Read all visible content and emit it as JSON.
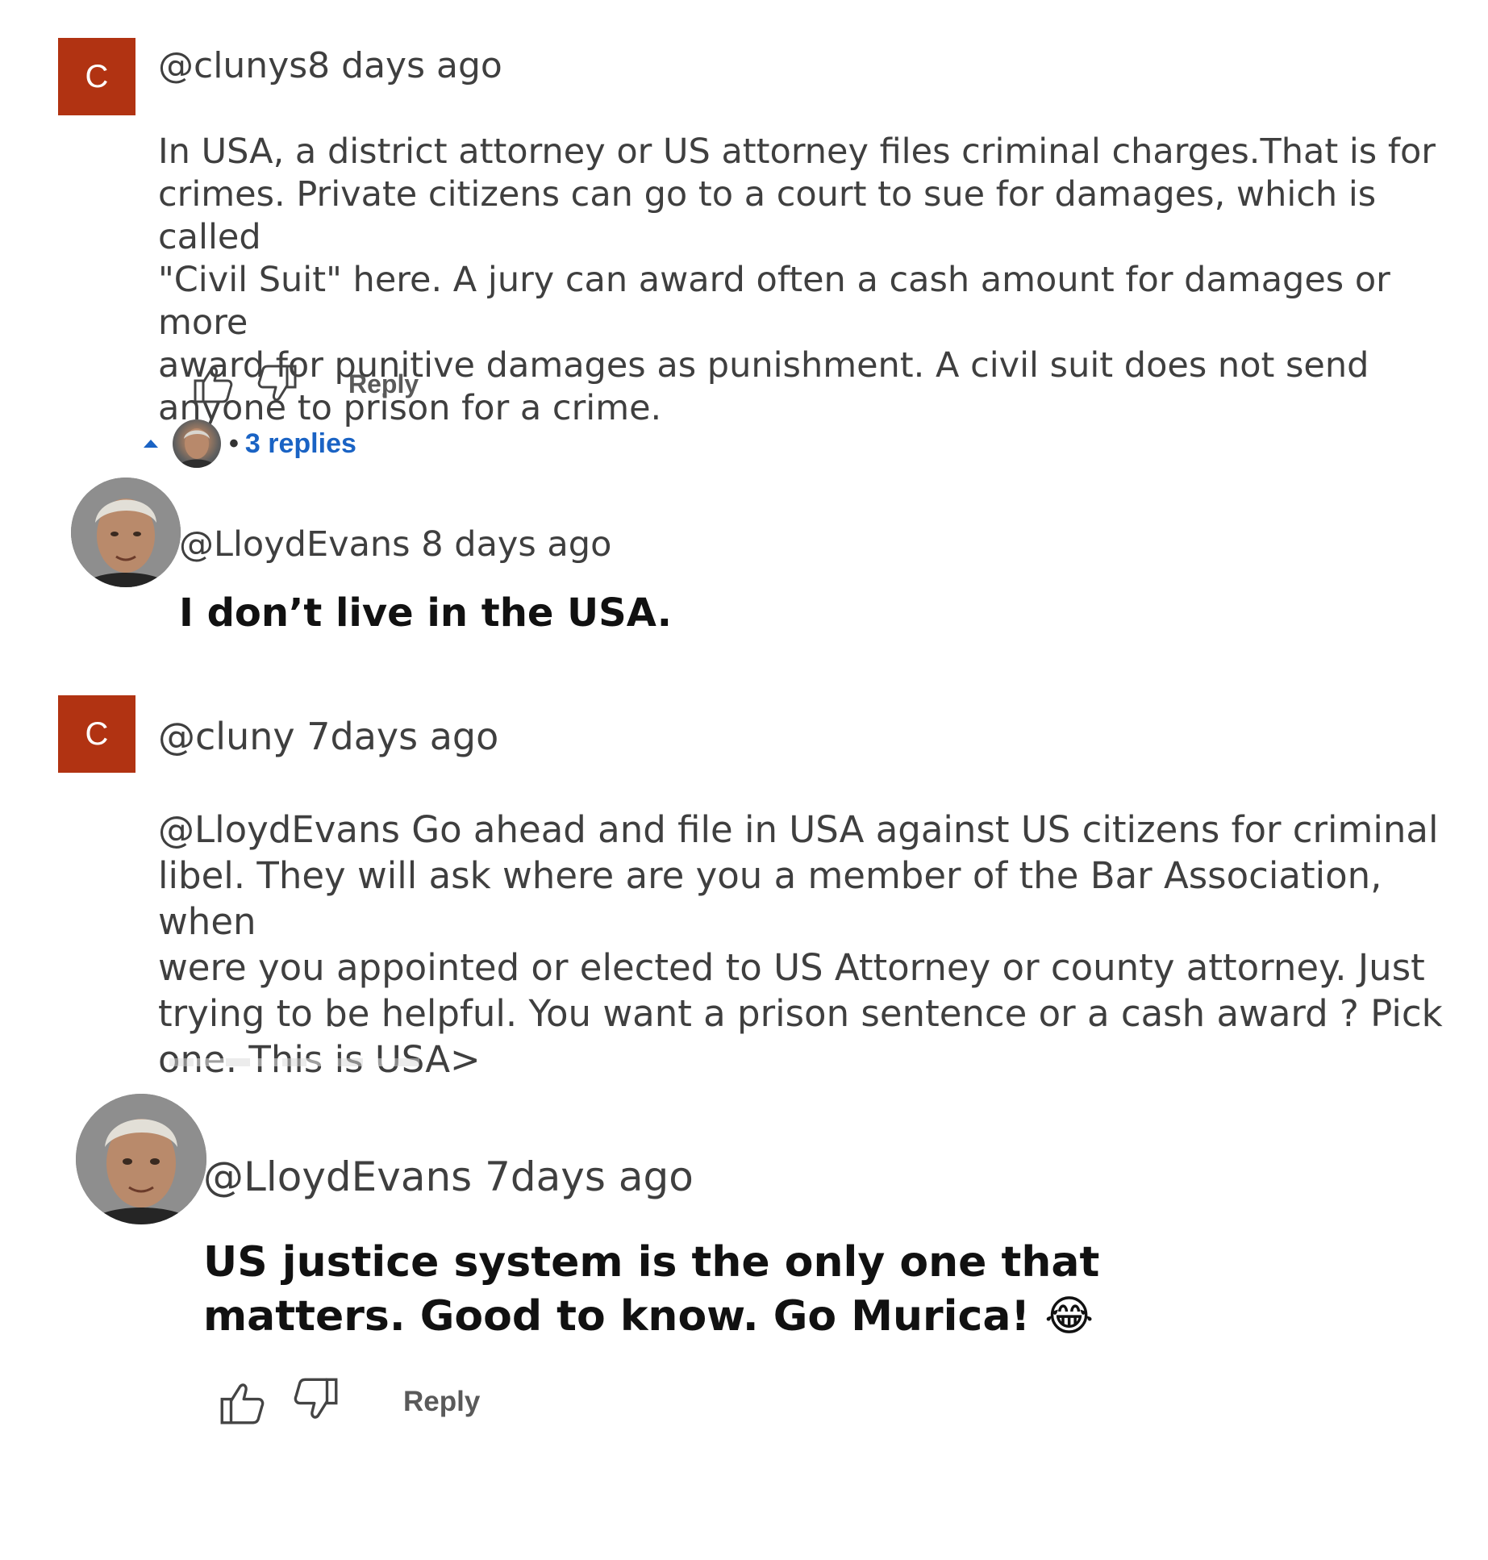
{
  "comments": [
    {
      "avatar_letter": "C",
      "author_line": "@clunys8 days ago",
      "text": "In USA, a district attorney or US attorney files criminal charges.That is for\ncrimes. Private citizens can go to a court to sue for damages, which is called\n\"Civil Suit\" here. A jury can award often a cash amount for damages or more\naward for punitive damages as punishment. A civil suit does not send\nanyone to prison for a crime.",
      "reply_label": "Reply",
      "replies_label": "3 replies"
    },
    {
      "author_line": "@LloydEvans 8 days ago",
      "text": "I don’t live in the USA."
    },
    {
      "avatar_letter": "C",
      "author_line": "@cluny 7days ago",
      "text": " @LloydEvans  Go ahead and file in USA against US citizens for criminal\nlibel. They will ask where are you a member of the Bar Association, when\nwere you appointed or elected to US Attorney or county attorney. Just\ntrying to be helpful. You want a prison sentence or a cash award ? Pick\none. This is USA>"
    },
    {
      "author_line": "@LloydEvans 7days ago",
      "text": "US justice system is the only one that\nmatters. Good to know. Go Murica! 😂",
      "reply_label": "Reply"
    }
  ],
  "icons": {
    "like": "thumbs-up-icon",
    "dislike": "thumbs-down-icon",
    "expand": "caret-up-icon"
  },
  "colors": {
    "avatar_bg": "#b13312",
    "link": "#1a63c4"
  }
}
